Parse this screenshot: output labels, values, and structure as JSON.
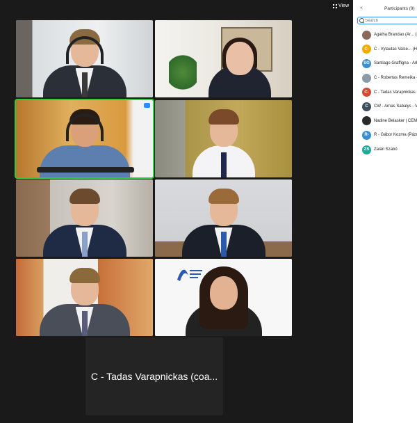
{
  "toolbar": {
    "view_label": "View"
  },
  "participants_panel": {
    "title": "Participants (9)",
    "collapse_glyph": "«",
    "search_placeholder": "Search",
    "items": [
      {
        "name": "Agatha Brandao (Ar... (H",
        "initials": "",
        "color": "#8a6a5a",
        "photo": true
      },
      {
        "name": "C - Vytautas Valce... (Ho",
        "initials": "C-",
        "color": "#f2a900"
      },
      {
        "name": "Santiago Graffigna - Arb",
        "initials": "SG",
        "color": "#3a8fd1"
      },
      {
        "name": "C - Robertas Remeika -...",
        "initials": "",
        "color": "#8b9aa8",
        "photo": true
      },
      {
        "name": "C - Tadas Varapnickas (",
        "initials": "C-",
        "color": "#d24a32"
      },
      {
        "name": "CW - Arnas Sabalys - Vi",
        "initials": "C",
        "color": "#3e4e5c"
      },
      {
        "name": "Nadine Belasker | CEM",
        "initials": "",
        "color": "#2a2a2a",
        "photo": true
      },
      {
        "name": "R - Gábor Kozma (Pázm",
        "initials": "R-",
        "color": "#3a8fd1"
      },
      {
        "name": "Zalán Szabó",
        "initials": "ZS",
        "color": "#1fa99a"
      }
    ]
  },
  "gallery": {
    "name_tile_label": "C - Tadas Varapnickas (coa...",
    "pin_badge_icon": "more-options-icon"
  }
}
